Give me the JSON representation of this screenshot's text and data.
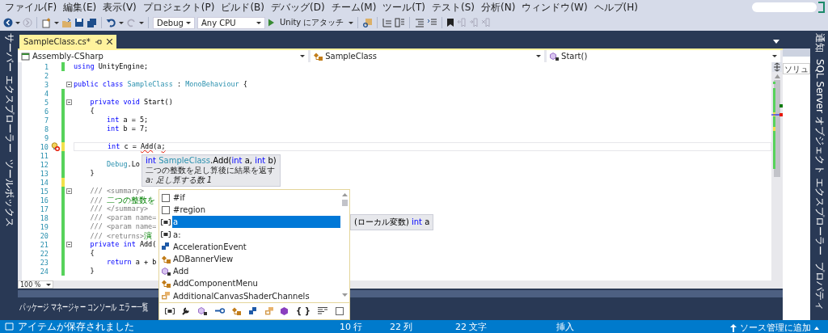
{
  "menu": [
    "ファイル(F)",
    "編集(E)",
    "表示(V)",
    "プロジェクト(P)",
    "ビルド(B)",
    "デバッグ(D)",
    "チーム(M)",
    "ツール(T)",
    "テスト(S)",
    "分析(N)",
    "ウィンドウ(W)",
    "ヘルプ(H)"
  ],
  "toolbar": {
    "configuration": "Debug",
    "platform": "Any CPU",
    "run_label": "Unity にアタッチ"
  },
  "left_dock": [
    "サーバー エクスプローラー",
    "ツールボックス"
  ],
  "right_dock": [
    "通知",
    "SQL Server オブジェクト エクスプローラー",
    "プロパティ"
  ],
  "document_tab": {
    "title": "SampleClass.cs*",
    "selected": true
  },
  "nav_bar": [
    "Assembly-CSharp",
    "SampleClass",
    "Start()"
  ],
  "editor": {
    "zoom": "100 %",
    "lines": [
      {
        "number": "1",
        "color": "#57d25b",
        "fold": false,
        "current": false,
        "code": [
          {
            "kind": "keyword",
            "text": "using"
          },
          {
            "kind": "plain",
            "text": " UnityEngine;"
          }
        ]
      },
      {
        "number": "2",
        "fold": false,
        "current": false
      },
      {
        "number": "3",
        "fold": true,
        "current": false,
        "code": [
          {
            "kind": "keyword",
            "text": "public class"
          },
          {
            "kind": "type",
            "text": " SampleClass"
          },
          {
            "kind": "plain",
            "text": " : "
          },
          {
            "kind": "type",
            "text": "MonoBehaviour"
          },
          {
            "kind": "plain",
            "text": " {"
          }
        ]
      },
      {
        "number": "4",
        "color": "#57d25b",
        "fold": false,
        "current": false
      },
      {
        "number": "5",
        "color": "#57d25b",
        "fold": true,
        "current": false,
        "code": [
          {
            "kind": "keyword",
            "text": "    private void"
          },
          {
            "kind": "plain",
            "text": " Start()"
          }
        ]
      },
      {
        "number": "6",
        "color": "#57d25b",
        "fold": false,
        "current": false,
        "code": [
          {
            "kind": "plain",
            "text": "    {"
          }
        ]
      },
      {
        "number": "7",
        "color": "#57d25b",
        "fold": false,
        "current": false,
        "code": [
          {
            "kind": "keyword",
            "text": "        int"
          },
          {
            "kind": "plain",
            "text": " a = 5;"
          }
        ]
      },
      {
        "number": "8",
        "color": "#57d25b",
        "fold": false,
        "current": false,
        "code": [
          {
            "kind": "keyword",
            "text": "        int"
          },
          {
            "kind": "plain",
            "text": " b = 7;"
          }
        ]
      },
      {
        "number": "9",
        "color": "#57d25b",
        "fold": false,
        "current": false
      },
      {
        "number": "10",
        "color": "#f2e14b",
        "fold": false,
        "current": true,
        "quick_action": true,
        "code": [
          {
            "kind": "keyword",
            "text": "        int"
          },
          {
            "kind": "plain",
            "text": " c = "
          },
          {
            "kind": "error",
            "text": "Add"
          },
          {
            "kind": "plain",
            "text": "(a"
          },
          {
            "kind": "error",
            "text": ";"
          }
        ]
      },
      {
        "number": "11",
        "color": "#57d25b",
        "fold": false,
        "current": false
      },
      {
        "number": "12",
        "color": "#57d25b",
        "fold": false,
        "current": false,
        "code": [
          {
            "kind": "type",
            "text": "        Debug"
          },
          {
            "kind": "plain",
            "text": ".Lo"
          }
        ]
      },
      {
        "number": "13",
        "color": "#57d25b",
        "fold": false,
        "current": false,
        "code": [
          {
            "kind": "plain",
            "text": "    }"
          }
        ]
      },
      {
        "number": "14",
        "color": "#f2e14b",
        "fold": false,
        "current": false
      },
      {
        "number": "15",
        "color": "#57d25b",
        "fold": true,
        "current": false,
        "code": [
          {
            "kind": "doc",
            "text": "    /// <summary>"
          }
        ]
      },
      {
        "number": "16",
        "color": "#57d25b",
        "fold": false,
        "current": false,
        "code": [
          {
            "kind": "doc",
            "text": "    /// "
          },
          {
            "kind": "comment",
            "text": "二つの整数を"
          }
        ]
      },
      {
        "number": "17",
        "color": "#57d25b",
        "fold": false,
        "current": false,
        "code": [
          {
            "kind": "doc",
            "text": "    /// </summary>"
          }
        ]
      },
      {
        "number": "18",
        "color": "#57d25b",
        "fold": false,
        "current": false,
        "code": [
          {
            "kind": "doc",
            "text": "    /// <param name="
          }
        ]
      },
      {
        "number": "19",
        "color": "#57d25b",
        "fold": false,
        "current": false,
        "code": [
          {
            "kind": "doc",
            "text": "    /// <param name="
          }
        ]
      },
      {
        "number": "20",
        "color": "#57d25b",
        "fold": false,
        "current": false,
        "code": [
          {
            "kind": "doc",
            "text": "    /// <returns>"
          },
          {
            "kind": "comment",
            "text": "演"
          }
        ]
      },
      {
        "number": "21",
        "color": "#57d25b",
        "fold": true,
        "current": false,
        "code": [
          {
            "kind": "keyword",
            "text": "    private int"
          },
          {
            "kind": "plain",
            "text": " Add("
          }
        ]
      },
      {
        "number": "22",
        "color": "#57d25b",
        "fold": false,
        "current": false,
        "code": [
          {
            "kind": "plain",
            "text": "    {"
          }
        ]
      },
      {
        "number": "23",
        "color": "#57d25b",
        "fold": false,
        "current": false,
        "code": [
          {
            "kind": "keyword",
            "text": "        return"
          },
          {
            "kind": "plain",
            "text": " a + b"
          }
        ]
      },
      {
        "number": "24",
        "color": "#57d25b",
        "fold": false,
        "current": false,
        "code": [
          {
            "kind": "plain",
            "text": "    }"
          }
        ]
      }
    ]
  },
  "signature_tooltip": {
    "signature": [
      {
        "kind": "keyword",
        "text": "int"
      },
      {
        "kind": "type",
        "text": " SampleClass"
      },
      {
        "kind": "plain",
        "text": ".Add("
      },
      {
        "kind": "keyword",
        "text": "int"
      },
      {
        "kind": "plain",
        "text": " a, "
      },
      {
        "kind": "keyword",
        "text": "int"
      },
      {
        "kind": "plain",
        "text": " b)"
      }
    ],
    "description": "二つの整数を足し算後に結果を返す",
    "parameter": "a: 足し算する数 1"
  },
  "completion": {
    "items": [
      {
        "label": "#if",
        "kind": "snippet",
        "selected": false
      },
      {
        "label": "#region",
        "kind": "snippet",
        "selected": false
      },
      {
        "label": "a",
        "kind": "local",
        "selected": true
      },
      {
        "label": "a:",
        "kind": "local",
        "selected": false
      },
      {
        "label": "AccelerationEvent",
        "kind": "struct",
        "selected": false
      },
      {
        "label": "ADBannerView",
        "kind": "class",
        "selected": false
      },
      {
        "label": "Add",
        "kind": "method",
        "selected": false
      },
      {
        "label": "AddComponentMenu",
        "kind": "class",
        "selected": false
      },
      {
        "label": "AdditionalCanvasShaderChannels",
        "kind": "enum",
        "selected": false
      }
    ],
    "filters": [
      {
        "kind": "local"
      },
      {
        "kind": "property"
      },
      {
        "kind": "method"
      },
      {
        "kind": "interface"
      },
      {
        "kind": "class"
      },
      {
        "kind": "struct"
      },
      {
        "kind": "enum"
      },
      {
        "kind": "field"
      },
      {
        "kind": "namespace",
        "glyph": "{ }"
      },
      {
        "kind": "keyword"
      },
      {
        "kind": "snippet"
      }
    ]
  },
  "item_tooltip": [
    {
      "kind": "plain",
      "text": "(ローカル変数) "
    },
    {
      "kind": "keyword",
      "text": "int"
    },
    {
      "kind": "plain",
      "text": " a"
    }
  ],
  "solution_explorer": {
    "search_placeholder": "ソリュ"
  },
  "bottom_tabs": [
    "パッケージ マネージャー コンソール",
    "エラー一覧"
  ],
  "status_bar": {
    "message": "アイテムが保存されました",
    "line": "10 行",
    "column": "22 列",
    "chars": "22 文字",
    "mode": "挿入",
    "source_control": "ソース管理に追加"
  }
}
